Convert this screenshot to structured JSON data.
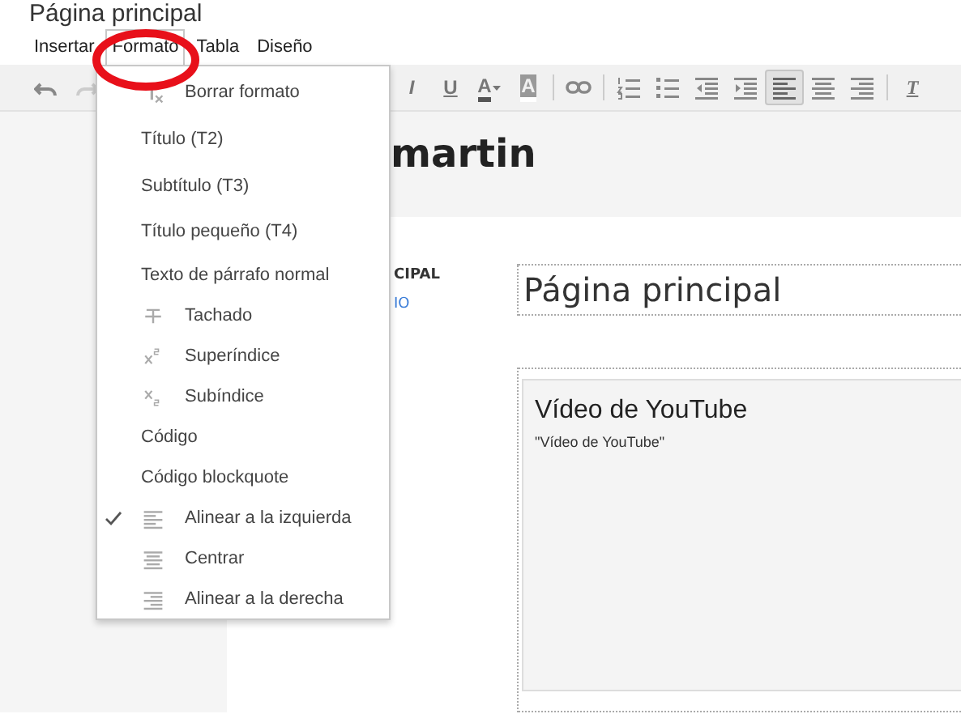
{
  "page_title": "Página principal",
  "menubar": [
    {
      "label": "Insertar",
      "selected": false
    },
    {
      "label": "Formato",
      "selected": true
    },
    {
      "label": "Tabla",
      "selected": false
    },
    {
      "label": "Diseño",
      "selected": false
    }
  ],
  "toolbar": [
    {
      "kind": "undo",
      "selected": false,
      "disabled": false
    },
    {
      "kind": "redo",
      "selected": false,
      "disabled": true
    },
    {
      "kind": "gap"
    },
    {
      "kind": "italic",
      "glyph": "I",
      "selected": false,
      "disabled": false
    },
    {
      "kind": "underline",
      "glyph": "U",
      "selected": false,
      "disabled": false
    },
    {
      "kind": "text-color",
      "glyph": "A",
      "selected": false,
      "disabled": false
    },
    {
      "kind": "highlight",
      "glyph": "A",
      "selected": false,
      "disabled": false
    },
    {
      "kind": "separator"
    },
    {
      "kind": "link",
      "selected": false,
      "disabled": false
    },
    {
      "kind": "separator"
    },
    {
      "kind": "numbered-list",
      "selected": false,
      "disabled": false
    },
    {
      "kind": "bullet-list",
      "selected": false,
      "disabled": false
    },
    {
      "kind": "outdent",
      "selected": false,
      "disabled": false
    },
    {
      "kind": "indent",
      "selected": false,
      "disabled": false
    },
    {
      "kind": "align-left",
      "selected": true,
      "disabled": false
    },
    {
      "kind": "align-center",
      "selected": false,
      "disabled": false
    },
    {
      "kind": "align-right",
      "selected": false,
      "disabled": false
    },
    {
      "kind": "separator"
    },
    {
      "kind": "clear",
      "glyph": "T",
      "selected": false,
      "disabled": false
    }
  ],
  "format_menu": [
    {
      "label": "Borrar formato",
      "kind": "clear",
      "checked": false
    },
    {
      "label": "Título (T2)",
      "kind": "plain",
      "checked": false
    },
    {
      "label": "Subtítulo (T3)",
      "kind": "plain",
      "checked": false
    },
    {
      "label": "Título pequeño (T4)",
      "kind": "plain",
      "checked": false
    },
    {
      "label": "Texto de párrafo normal",
      "kind": "plain",
      "checked": false
    },
    {
      "label": "Tachado",
      "kind": "strike",
      "checked": false
    },
    {
      "label": "Superíndice",
      "kind": "sup",
      "checked": false
    },
    {
      "label": "Subíndice",
      "kind": "sub",
      "checked": false
    },
    {
      "label": "Código",
      "kind": "plain",
      "checked": false
    },
    {
      "label": "Código blockquote",
      "kind": "plain",
      "checked": false
    },
    {
      "label": "Alinear a la izquierda",
      "kind": "align-left",
      "checked": true
    },
    {
      "label": "Centrar",
      "kind": "align-center",
      "checked": false
    },
    {
      "label": "Alinear a la derecha",
      "kind": "align-right",
      "checked": false
    }
  ],
  "site_name": "martin",
  "nav": [
    {
      "label": "CIPAL",
      "selected": true
    },
    {
      "label": "IO",
      "selected": false
    }
  ],
  "page_heading": "Página principal",
  "gadget": {
    "title": "Vídeo de YouTube",
    "caption": "\"Vídeo de YouTube\""
  }
}
